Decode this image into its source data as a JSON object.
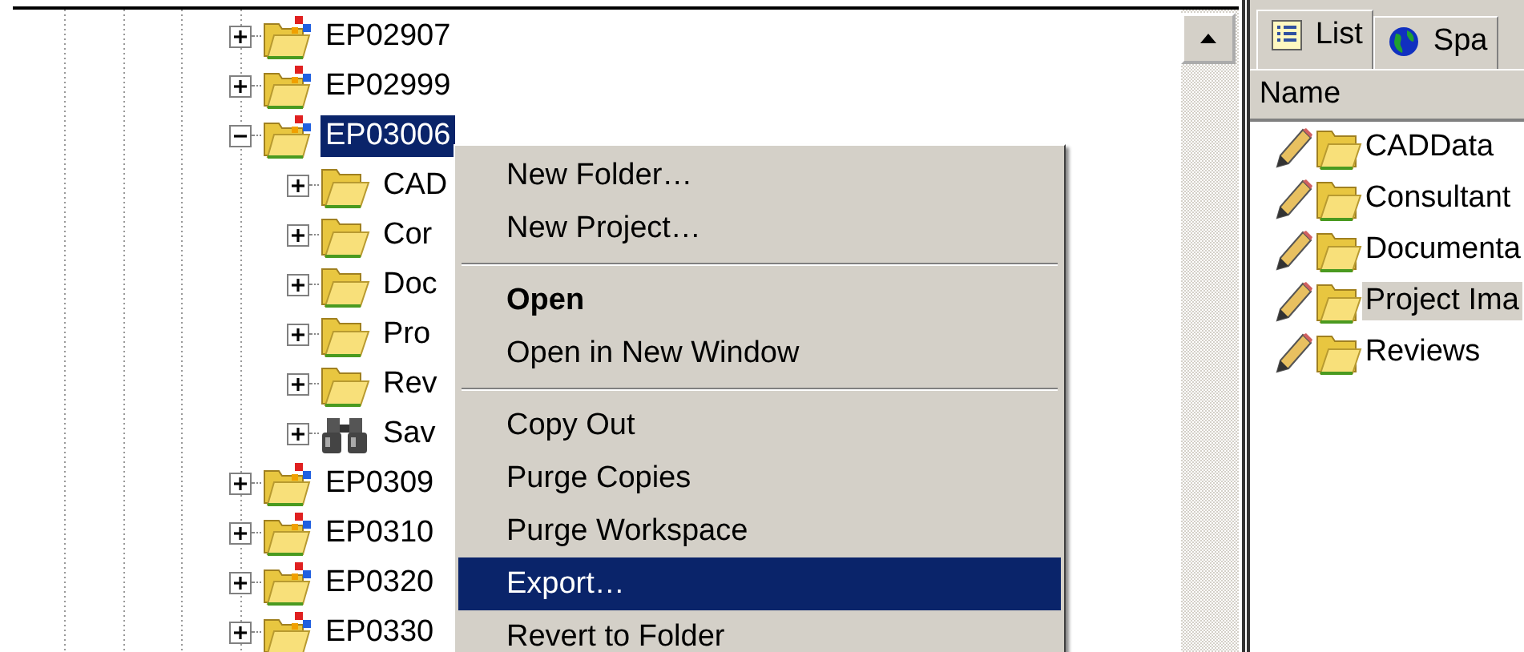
{
  "tree": {
    "items": [
      {
        "label": "EP02907",
        "kind": "project",
        "expanded": false,
        "selected": false
      },
      {
        "label": "EP02999",
        "kind": "project",
        "expanded": false,
        "selected": false
      },
      {
        "label": "EP03006",
        "kind": "project",
        "expanded": true,
        "selected": true,
        "children": [
          {
            "label": "CAD",
            "kind": "folder",
            "expanded": false,
            "selected": false
          },
          {
            "label": "Cor",
            "kind": "folder",
            "expanded": false,
            "selected": false
          },
          {
            "label": "Doc",
            "kind": "folder",
            "expanded": false,
            "selected": false
          },
          {
            "label": "Pro",
            "kind": "folder",
            "expanded": false,
            "selected": false
          },
          {
            "label": "Rev",
            "kind": "folder",
            "expanded": false,
            "selected": false
          },
          {
            "label": "Sav",
            "kind": "search",
            "expanded": false,
            "selected": false
          }
        ]
      },
      {
        "label": "EP0309",
        "kind": "project",
        "expanded": false,
        "selected": false
      },
      {
        "label": "EP0310",
        "kind": "project",
        "expanded": false,
        "selected": false
      },
      {
        "label": "EP0320",
        "kind": "project",
        "expanded": false,
        "selected": false
      },
      {
        "label": "EP0330",
        "kind": "project",
        "expanded": false,
        "selected": false
      }
    ]
  },
  "context_menu": {
    "items": [
      {
        "kind": "item",
        "label": "New Folder…",
        "bold": false,
        "selected": false
      },
      {
        "kind": "item",
        "label": "New Project…",
        "bold": false,
        "selected": false
      },
      {
        "kind": "separator"
      },
      {
        "kind": "item",
        "label": "Open",
        "bold": true,
        "selected": false
      },
      {
        "kind": "item",
        "label": "Open in New Window",
        "bold": false,
        "selected": false
      },
      {
        "kind": "separator"
      },
      {
        "kind": "item",
        "label": "Copy Out",
        "bold": false,
        "selected": false
      },
      {
        "kind": "item",
        "label": "Purge Copies",
        "bold": false,
        "selected": false
      },
      {
        "kind": "item",
        "label": "Purge Workspace",
        "bold": false,
        "selected": false
      },
      {
        "kind": "item",
        "label": "Export…",
        "bold": false,
        "selected": true
      },
      {
        "kind": "item",
        "label": "Revert to Folder",
        "bold": false,
        "selected": false
      }
    ]
  },
  "right_panel": {
    "tabs": [
      {
        "label": "List",
        "kind": "list",
        "selected": true
      },
      {
        "label": "Spa",
        "kind": "globe",
        "selected": false
      }
    ],
    "columns": [
      "Name"
    ],
    "items": [
      {
        "label": "CADData",
        "selected": false
      },
      {
        "label": "Consultant",
        "selected": false
      },
      {
        "label": "Documenta",
        "selected": false
      },
      {
        "label": "Project Ima",
        "selected": true
      },
      {
        "label": "Reviews",
        "selected": false
      }
    ]
  }
}
